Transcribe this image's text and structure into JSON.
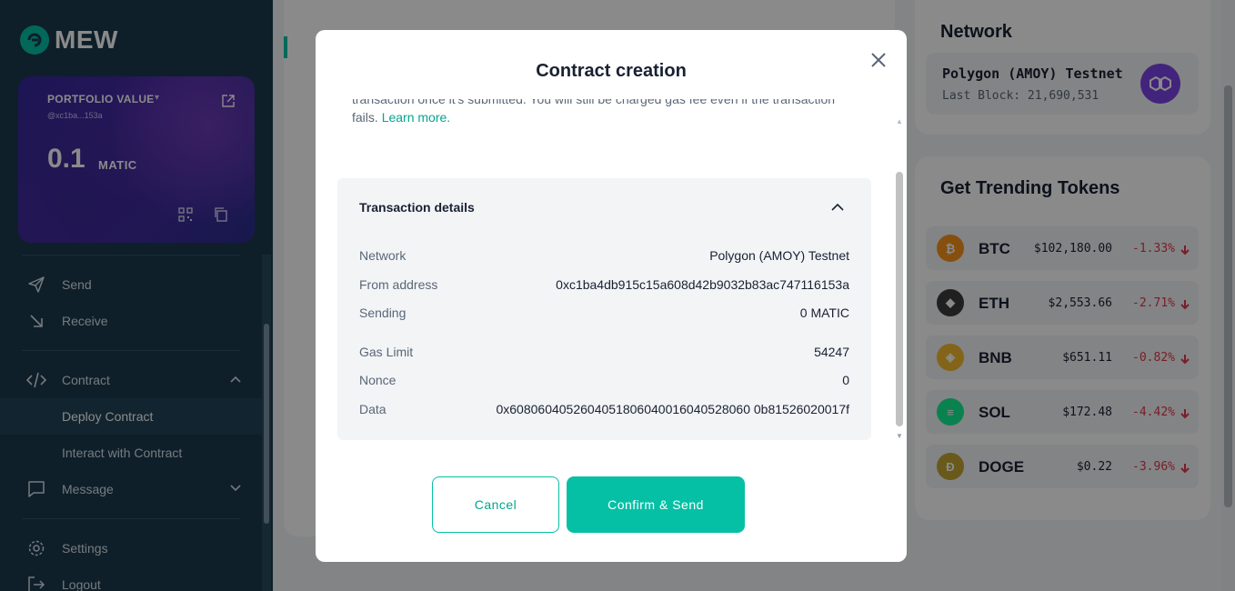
{
  "brand": {
    "name": "MEW",
    "accent": "#05c0a5",
    "sidebar_bg": "#1b3a4e"
  },
  "portfolio": {
    "label": "PORTFOLIO VALUE",
    "address": "@xc1ba...153a",
    "amount": "0.1",
    "unit": "MATIC"
  },
  "sidebar": {
    "send": "Send",
    "receive": "Receive",
    "contract": "Contract",
    "deploy_contract": "Deploy Contract",
    "interact_contract": "Interact with Contract",
    "message": "Message",
    "settings": "Settings",
    "logout": "Logout"
  },
  "network_panel": {
    "title": "Network",
    "name": "Polygon (AMOY) Testnet",
    "last_block": "Last Block: 21,690,531"
  },
  "trending": {
    "title": "Get Trending Tokens",
    "tokens": [
      {
        "symbol": "BTC",
        "price": "$102,180.00",
        "change": "-1.33%",
        "color": "#f7931a",
        "icon": "bitcoin-icon"
      },
      {
        "symbol": "ETH",
        "price": "$2,553.66",
        "change": "-2.71%",
        "color": "#3c3c3d",
        "icon": "ethereum-icon"
      },
      {
        "symbol": "BNB",
        "price": "$651.11",
        "change": "-0.82%",
        "color": "#f3ba2f",
        "icon": "bnb-icon"
      },
      {
        "symbol": "SOL",
        "price": "$172.48",
        "change": "-4.42%",
        "color": "#14f195",
        "icon": "solana-icon"
      },
      {
        "symbol": "DOGE",
        "price": "$0.22",
        "change": "-3.96%",
        "color": "#c2a633",
        "icon": "dogecoin-icon"
      }
    ],
    "negative_color": "#e0384d"
  },
  "modal": {
    "title": "Contract creation",
    "partial_line": "transaction once it's submitted. You will still be charged gas fee even if the transaction",
    "fails_text": "fails. ",
    "learn_more": "Learn more.",
    "details_title": "Transaction details",
    "rows": [
      {
        "label": "Network",
        "value": "Polygon (AMOY) Testnet"
      },
      {
        "label": "From address",
        "value": "0xc1ba4db915c15a608d42b9032b83ac747116153a"
      },
      {
        "label": "Sending",
        "value": "0 MATIC"
      },
      {
        "label": "Gas Limit",
        "value": "54247"
      },
      {
        "label": "Nonce",
        "value": "0"
      },
      {
        "label": "Data",
        "value": "0x6080604052604051806040016040528060 0b81526020017f"
      }
    ],
    "cancel": "Cancel",
    "confirm": "Confirm & Send"
  }
}
